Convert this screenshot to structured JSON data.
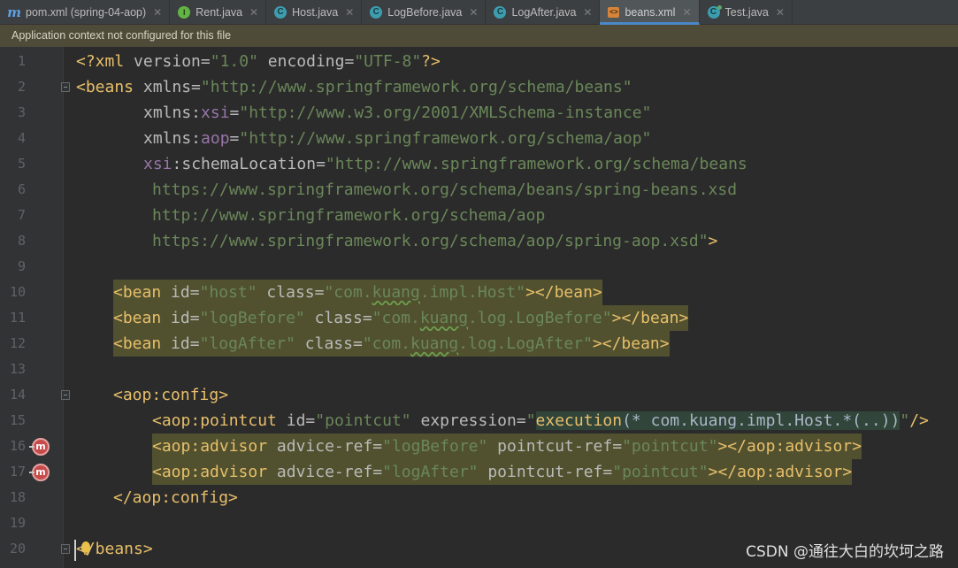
{
  "tabs": [
    {
      "label": "pom.xml (spring-04-aop)",
      "icon": "maven-icon"
    },
    {
      "label": "Rent.java",
      "icon": "interface-icon"
    },
    {
      "label": "Host.java",
      "icon": "class-icon"
    },
    {
      "label": "LogBefore.java",
      "icon": "class-icon"
    },
    {
      "label": "LogAfter.java",
      "icon": "class-icon"
    },
    {
      "label": "beans.xml",
      "icon": "xml-file-icon",
      "active": true
    },
    {
      "label": "Test.java",
      "icon": "test-class-icon"
    }
  ],
  "banner": {
    "text": "Application context not configured for this file"
  },
  "editor": {
    "line_numbers": [
      "1",
      "2",
      "3",
      "4",
      "5",
      "6",
      "7",
      "8",
      "9",
      "10",
      "11",
      "12",
      "13",
      "14",
      "15",
      "16",
      "17",
      "18",
      "19",
      "20"
    ],
    "code": {
      "l1": {
        "a": "<?xml ",
        "b": "version",
        "c": "=",
        "d": "\"1.0\"",
        "e": " ",
        "f": "encoding",
        "g": "=",
        "h": "\"UTF-8\"",
        "i": "?>"
      },
      "l2": {
        "a": "<beans ",
        "b": "xmlns",
        "c": "=",
        "d": "\"http://www.springframework.org/schema/beans\""
      },
      "l3": {
        "a": "xmlns:",
        "b": "xsi",
        "c": "=",
        "d": "\"http://www.w3.org/2001/XMLSchema-instance\""
      },
      "l4": {
        "a": "xmlns:",
        "b": "aop",
        "c": "=",
        "d": "\"http://www.springframework.org/schema/aop\""
      },
      "l5": {
        "a": "xsi",
        "b": ":schemaLocation",
        "c": "=",
        "d": "\"http://www.springframework.org/schema/beans"
      },
      "l6": {
        "d": "https://www.springframework.org/schema/beans/spring-beans.xsd"
      },
      "l7": {
        "d": "http://www.springframework.org/schema/aop"
      },
      "l8": {
        "d": "https://www.springframework.org/schema/aop/spring-aop.xsd\"",
        "e": ">"
      },
      "l10": {
        "a": "<bean ",
        "b": "id",
        "c": "=",
        "d": "\"host\"",
        "e": " class",
        "f": "=",
        "g1": "\"com.",
        "g2": "kuang",
        "g3": ".impl.Host\"",
        "h": "></bean>"
      },
      "l11": {
        "a": "<bean ",
        "b": "id",
        "c": "=",
        "d": "\"logBefore\"",
        "e": " class",
        "f": "=",
        "g1": "\"com.",
        "g2": "kuang",
        "g3": ".log.LogBefore\"",
        "h": "></bean>"
      },
      "l12": {
        "a": "<bean ",
        "b": "id",
        "c": "=",
        "d": "\"logAfter\"",
        "e": " class",
        "f": "=",
        "g1": "\"com.",
        "g2": "kuang",
        "g3": ".log.LogAfter\"",
        "h": "></bean>"
      },
      "l14": {
        "a": "<aop",
        "b": ":config",
        "c": ">"
      },
      "l15": {
        "a": "<aop",
        "b": ":pointcut ",
        "c": "id",
        "d": "=",
        "e": "\"pointcut\"",
        "f": " expression",
        "g": "=",
        "h": "\"",
        "i": "execution",
        "j": "(* com.kuang.impl.Host.*(..))",
        "k": "\"",
        "l": "/>"
      },
      "l16": {
        "a": "<aop",
        "b": ":advisor ",
        "c": "advice-ref",
        "d": "=",
        "e": "\"logBefore\"",
        "f": " pointcut-ref",
        "g": "=",
        "h": "\"pointcut\"",
        "i": "></aop",
        "j": ":advisor",
        "k": ">"
      },
      "l17": {
        "a": "<aop",
        "b": ":advisor ",
        "c": "advice-ref",
        "d": "=",
        "e": "\"logAfter\"",
        "f": " pointcut-ref",
        "g": "=",
        "h": "\"pointcut\"",
        "i": "></aop",
        "j": ":advisor",
        "k": ">"
      },
      "l18": {
        "a": "</aop",
        "b": ":config",
        "c": ">"
      },
      "l20": {
        "a": "</beans>"
      }
    },
    "gutter_icons": [
      {
        "line": "16",
        "icon": "aop-advice-icon"
      },
      {
        "line": "17",
        "icon": "aop-advice-icon"
      }
    ],
    "gutter_icon_glyph": "m"
  },
  "watermark": "CSDN @通往大白的坎坷之路",
  "colors": {
    "tag": "#e8bf6a",
    "attribute": "#bababa",
    "namespace": "#9876aa",
    "string": "#6a8759",
    "highlight": "#51512f"
  }
}
